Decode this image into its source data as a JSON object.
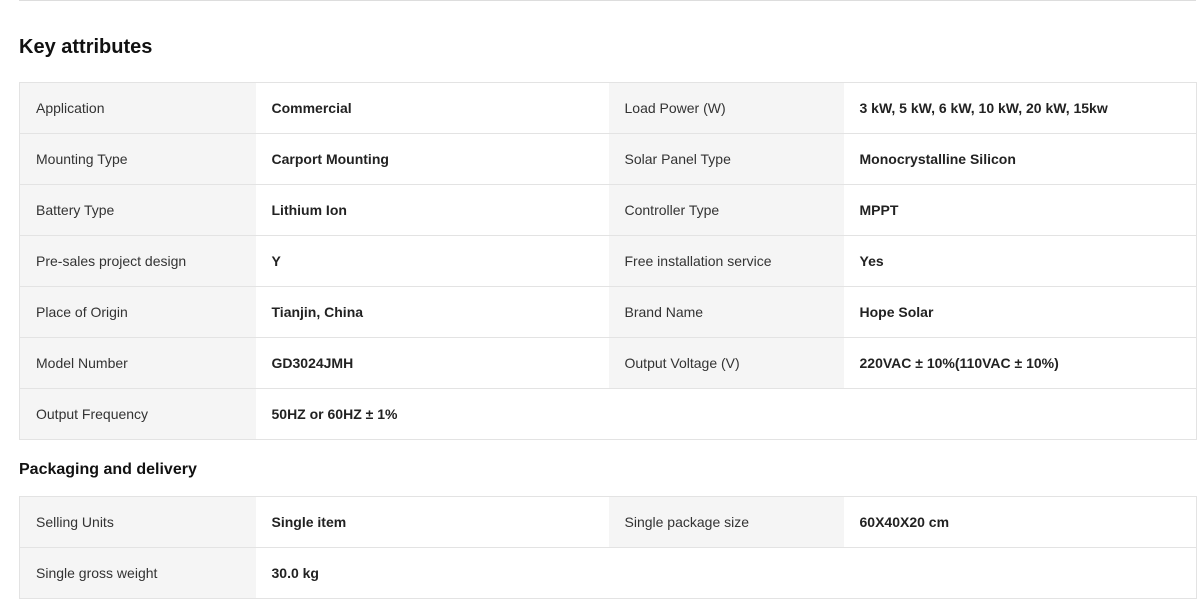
{
  "key_attributes": {
    "title": "Key attributes",
    "rows": [
      {
        "label1": "Application",
        "value1": "Commercial",
        "label2": "Load Power (W)",
        "value2": "3 kW, 5 kW, 6 kW, 10 kW, 20 kW, 15kw"
      },
      {
        "label1": "Mounting Type",
        "value1": "Carport Mounting",
        "label2": "Solar Panel Type",
        "value2": "Monocrystalline Silicon"
      },
      {
        "label1": "Battery Type",
        "value1": "Lithium Ion",
        "label2": "Controller Type",
        "value2": "MPPT"
      },
      {
        "label1": "Pre-sales project design",
        "value1": "Y",
        "label2": "Free installation service",
        "value2": "Yes"
      },
      {
        "label1": "Place of Origin",
        "value1": "Tianjin, China",
        "label2": "Brand Name",
        "value2": "Hope Solar"
      },
      {
        "label1": "Model Number",
        "value1": "GD3024JMH",
        "label2": "Output Voltage (V)",
        "value2": "220VAC ± 10%(110VAC ± 10%)"
      },
      {
        "label1": "Output Frequency",
        "value1": "50HZ or 60HZ ± 1%"
      }
    ]
  },
  "packaging": {
    "title": "Packaging and delivery",
    "rows": [
      {
        "label1": "Selling Units",
        "value1": "Single item",
        "label2": "Single package size",
        "value2": "60X40X20 cm"
      },
      {
        "label1": "Single gross weight",
        "value1": "30.0 kg"
      }
    ]
  },
  "colors": {
    "label_bg": "#f5f5f5",
    "border": "#e3e3e3",
    "text": "#222222"
  }
}
